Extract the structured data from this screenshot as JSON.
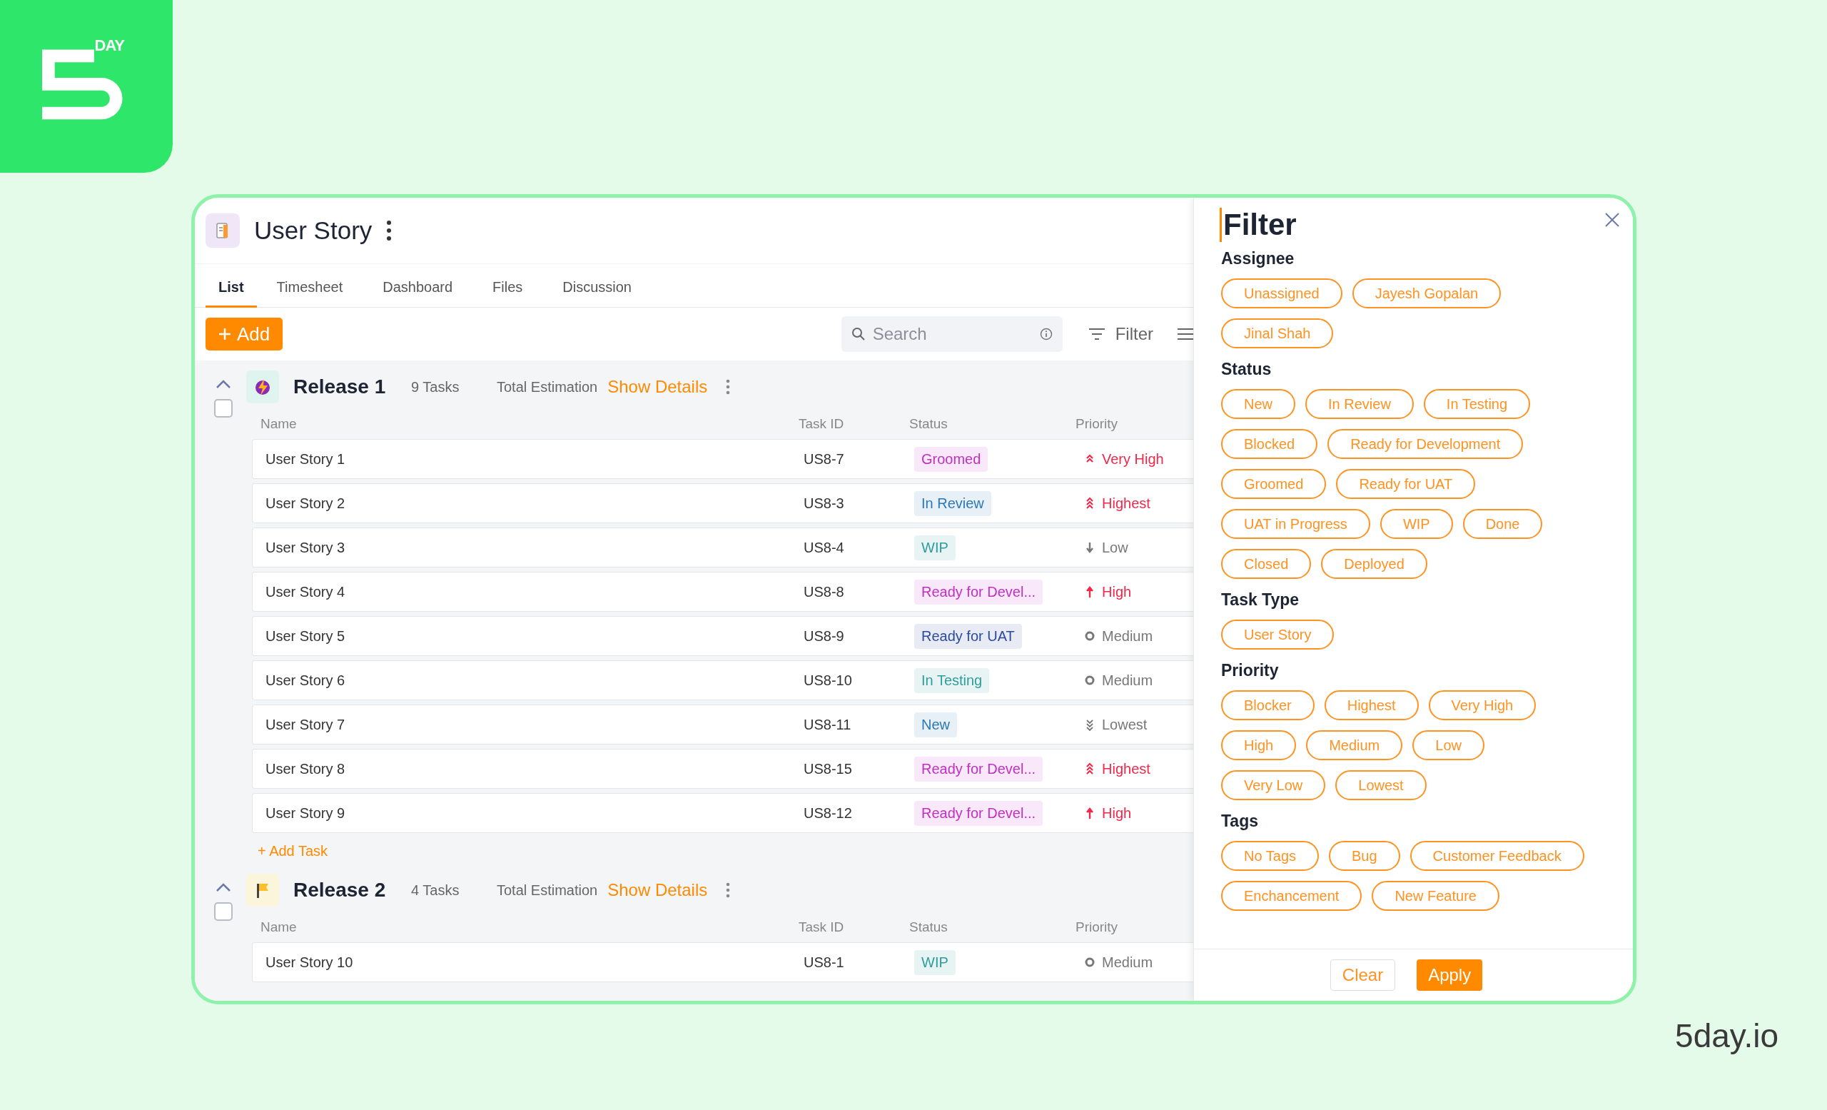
{
  "brand": {
    "wordmark": "DAY",
    "site": "5day.io"
  },
  "header": {
    "title": "User Story"
  },
  "tabs": [
    {
      "label": "List",
      "selected": true
    },
    {
      "label": "Timesheet",
      "selected": false
    },
    {
      "label": "Dashboard",
      "selected": false
    },
    {
      "label": "Files",
      "selected": false
    },
    {
      "label": "Discussion",
      "selected": false
    }
  ],
  "toolbar": {
    "add_button": "Add",
    "search": {
      "placeholder": "Search"
    },
    "filter_button": "Filter"
  },
  "groups": [
    {
      "kind": "lightning",
      "name": "Release 1",
      "task_count": "9 Tasks",
      "estimation_label": "Total Estimation",
      "details_link": "Show Details",
      "expanded": true,
      "checked": false,
      "columns": [
        "Name",
        "Task ID",
        "Status",
        "Priority"
      ],
      "rows": [
        {
          "name": "User Story 1",
          "task_id": "US8-7",
          "status": {
            "label": "Groomed",
            "color": "#c030c4"
          },
          "priority": {
            "label": "Very High",
            "kind": "very_high"
          }
        },
        {
          "name": "User Story 2",
          "task_id": "US8-3",
          "status": {
            "label": "In Review",
            "color": "#2b78b4"
          },
          "priority": {
            "label": "Highest",
            "kind": "highest"
          }
        },
        {
          "name": "User Story 3",
          "task_id": "US8-4",
          "status": {
            "label": "WIP",
            "color": "#2f9c9c"
          },
          "priority": {
            "label": "Low",
            "kind": "low"
          }
        },
        {
          "name": "User Story 4",
          "task_id": "US8-8",
          "status": {
            "label": "Ready for Devel...",
            "color": "#c030c4"
          },
          "priority": {
            "label": "High",
            "kind": "high"
          }
        },
        {
          "name": "User Story 5",
          "task_id": "US8-9",
          "status": {
            "label": "Ready for UAT",
            "color": "#2c4b9c"
          },
          "priority": {
            "label": "Medium",
            "kind": "medium"
          }
        },
        {
          "name": "User Story 6",
          "task_id": "US8-10",
          "status": {
            "label": "In Testing",
            "color": "#2f9c9c"
          },
          "priority": {
            "label": "Medium",
            "kind": "medium"
          }
        },
        {
          "name": "User Story 7",
          "task_id": "US8-11",
          "status": {
            "label": "New",
            "color": "#2b78b4"
          },
          "priority": {
            "label": "Lowest",
            "kind": "lowest"
          }
        },
        {
          "name": "User Story 8",
          "task_id": "US8-15",
          "status": {
            "label": "Ready for Devel...",
            "color": "#c030c4"
          },
          "priority": {
            "label": "Highest",
            "kind": "highest"
          }
        },
        {
          "name": "User Story 9",
          "task_id": "US8-12",
          "status": {
            "label": "Ready for Devel...",
            "color": "#c030c4"
          },
          "priority": {
            "label": "High",
            "kind": "high"
          }
        }
      ],
      "add_task": "+ Add Task"
    },
    {
      "kind": "flag",
      "name": "Release 2",
      "task_count": "4 Tasks",
      "estimation_label": "Total Estimation",
      "details_link": "Show Details",
      "expanded": true,
      "checked": false,
      "columns": [
        "Name",
        "Task ID",
        "Status",
        "Priority"
      ],
      "rows": [
        {
          "name": "User Story 10",
          "task_id": "US8-1",
          "status": {
            "label": "WIP",
            "color": "#2f9c9c"
          },
          "priority": {
            "label": "Medium",
            "kind": "medium"
          }
        }
      ]
    }
  ],
  "filter": {
    "title": "Filter",
    "sections": [
      {
        "title": "Assignee",
        "chips": [
          {
            "label": "Unassigned",
            "selected": false
          },
          {
            "label": "Jayesh Gopalan",
            "selected": false
          },
          {
            "label": "Jinal Shah",
            "selected": false
          }
        ]
      },
      {
        "title": "Status",
        "chips": [
          {
            "label": "New",
            "selected": false
          },
          {
            "label": "In Review",
            "selected": false
          },
          {
            "label": "In Testing",
            "selected": false
          },
          {
            "label": "Blocked",
            "selected": false
          },
          {
            "label": "Ready for Development",
            "selected": false
          },
          {
            "label": "Groomed",
            "selected": false
          },
          {
            "label": "Ready for UAT",
            "selected": false
          },
          {
            "label": "UAT in Progress",
            "selected": false
          },
          {
            "label": "WIP",
            "selected": false
          },
          {
            "label": "Done",
            "selected": false
          },
          {
            "label": "Closed",
            "selected": false
          },
          {
            "label": "Deployed",
            "selected": false
          }
        ]
      },
      {
        "title": "Task Type",
        "chips": [
          {
            "label": "User Story",
            "selected": false
          }
        ]
      },
      {
        "title": "Priority",
        "chips": [
          {
            "label": "Blocker",
            "selected": false
          },
          {
            "label": "Highest",
            "selected": false
          },
          {
            "label": "Very High",
            "selected": false
          },
          {
            "label": "High",
            "selected": false
          },
          {
            "label": "Medium",
            "selected": false
          },
          {
            "label": "Low",
            "selected": false
          },
          {
            "label": "Very Low",
            "selected": false
          },
          {
            "label": "Lowest",
            "selected": false
          }
        ]
      },
      {
        "title": "Tags",
        "chips": [
          {
            "label": "No Tags",
            "selected": false
          },
          {
            "label": "Bug",
            "selected": false
          },
          {
            "label": "Customer Feedback",
            "selected": false
          },
          {
            "label": "Enchancement",
            "selected": false
          },
          {
            "label": "New Feature",
            "selected": false
          }
        ]
      }
    ],
    "clear_button": "Clear",
    "apply_button": "Apply"
  }
}
